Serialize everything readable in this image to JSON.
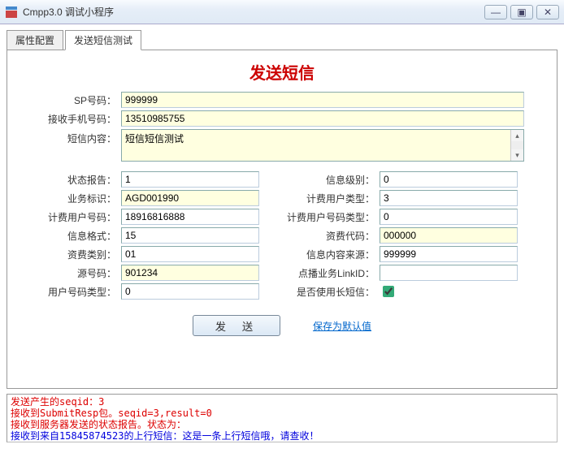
{
  "window": {
    "title": "Cmpp3.0 调试小程序",
    "min": "—",
    "max": "▣",
    "close": "✕"
  },
  "tabs": {
    "config": "属性配置",
    "sendtest": "发送短信测试"
  },
  "heading": "发送短信",
  "labels": {
    "sp": "SP号码：",
    "phone": "接收手机号码：",
    "content": "短信内容：",
    "status": "状态报告：",
    "biz": "业务标识：",
    "feeuser": "计费用户号码：",
    "msgfmt": "信息格式：",
    "feetype": "资费类别：",
    "src": "源号码：",
    "usernumtype": "用户号码类型：",
    "infolevel": "信息级别：",
    "feeusertype": "计费用户类型：",
    "feeusernumtype": "计费用户号码类型：",
    "feecode": "资费代码：",
    "infosrc": "信息内容来源：",
    "linkid": "点播业务LinkID：",
    "uselong": "是否使用长短信："
  },
  "values": {
    "sp": "999999",
    "phone": "13510985755",
    "content": "短信短信测试",
    "status": "1",
    "biz": "AGD001990",
    "feeuser": "18916816888",
    "msgfmt": "15",
    "feetype": "01",
    "src": "901234",
    "usernumtype": "0",
    "infolevel": "0",
    "feeusertype": "3",
    "feeusernumtype": "0",
    "feecode": "000000",
    "infosrc": "999999",
    "linkid": "",
    "uselong": true
  },
  "buttons": {
    "send": "发 送",
    "savedefault": "保存为默认值"
  },
  "log": {
    "l1": "发送产生的seqid：3",
    "l2": "接收到SubmitResp包。seqid=3,result=0",
    "l3": "接收到服务器发送的状态报告。状态为：",
    "l4": "接收到来自15845874523的上行短信：这是一条上行短信哦，请查收！"
  }
}
